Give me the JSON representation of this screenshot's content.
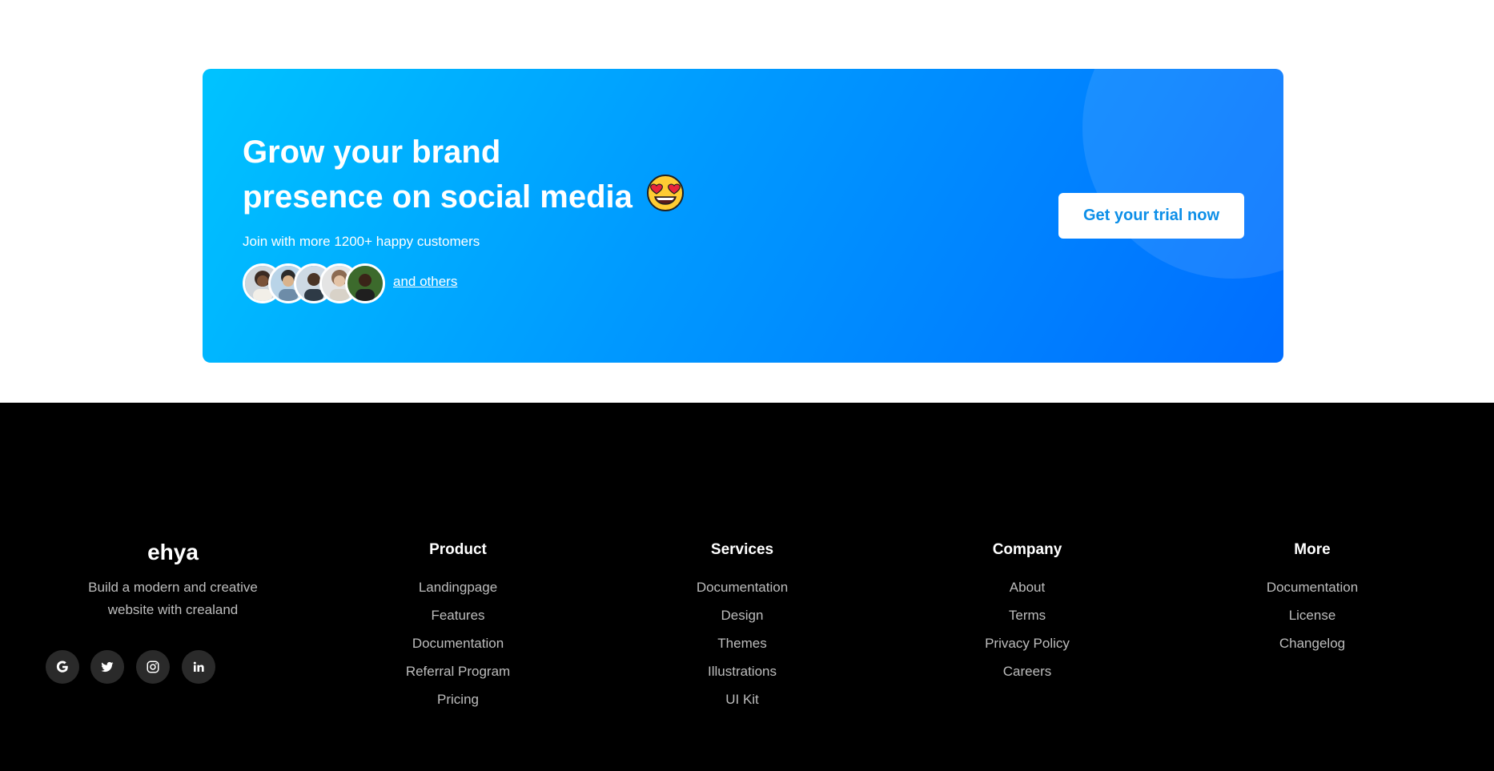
{
  "cta": {
    "title_line1": "Grow your brand",
    "title_line2": "presence on social media",
    "emoji_icon": "heart-eyes-emoji",
    "subtitle": "Join with more 1200+ happy customers",
    "others_link": "and others",
    "button_label": "Get your trial now",
    "gradient_start": "#00c3ff",
    "gradient_end": "#006dff"
  },
  "footer": {
    "brand": {
      "name": "ehya",
      "description_line1": "Build a modern and creative",
      "description_line2": "website with crealand"
    },
    "socials": [
      {
        "icon": "google-icon"
      },
      {
        "icon": "twitter-icon"
      },
      {
        "icon": "instagram-icon"
      },
      {
        "icon": "linkedin-icon"
      }
    ],
    "columns": [
      {
        "title": "Product",
        "links": [
          "Landingpage",
          "Features",
          "Documentation",
          "Referral Program",
          "Pricing"
        ]
      },
      {
        "title": "Services",
        "links": [
          "Documentation",
          "Design",
          "Themes",
          "Illustrations",
          "UI Kit"
        ]
      },
      {
        "title": "Company",
        "links": [
          "About",
          "Terms",
          "Privacy Policy",
          "Careers"
        ]
      },
      {
        "title": "More",
        "links": [
          "Documentation",
          "License",
          "Changelog"
        ]
      }
    ]
  }
}
